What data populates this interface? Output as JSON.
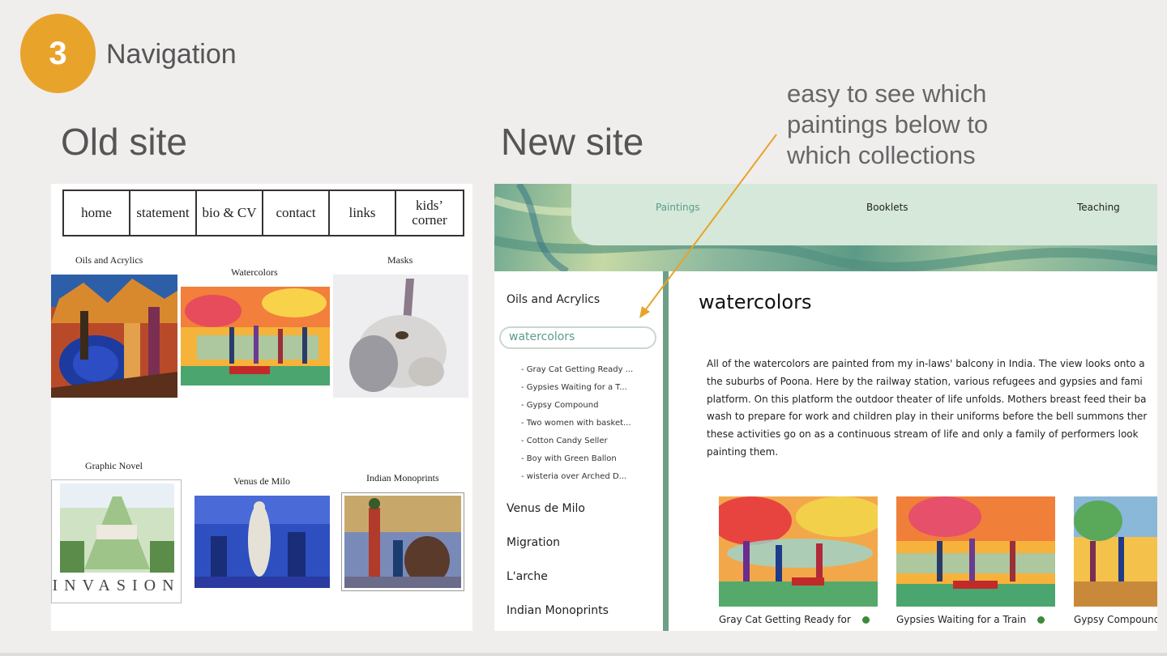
{
  "slide": {
    "badge_number": "3",
    "title": "Navigation",
    "old_heading": "Old site",
    "new_heading": "New site",
    "callout": "easy to see which paintings below to which collections",
    "accent_color": "#e8a32b"
  },
  "old_site": {
    "nav": [
      "home",
      "statement",
      "bio & CV",
      "contact",
      "links",
      "kids’ corner"
    ],
    "collections": [
      {
        "label": "Oils and Acrylics"
      },
      {
        "label": "Watercolors"
      },
      {
        "label": "Masks"
      },
      {
        "label": "Graphic Novel"
      },
      {
        "label": "Venus de Milo"
      },
      {
        "label": "Indian Monoprints"
      }
    ],
    "graphic_novel_caption": "INVASION"
  },
  "new_site": {
    "topnav": {
      "paintings": "Paintings",
      "booklets": "Booklets",
      "teaching": "Teaching"
    },
    "sidebar": {
      "oils": "Oils and Acrylics",
      "active": "watercolors",
      "sub_items": [
        "- Gray Cat Getting Ready ...",
        "- Gypsies Waiting for a T...",
        "- Gypsy Compound",
        "- Two women with basket...",
        "- Cotton Candy Seller",
        "- Boy with Green Ballon",
        "- wisteria over Arched D..."
      ],
      "venus": "Venus de Milo",
      "migration": "Migration",
      "larche": "L'arche",
      "indian": "Indian Monoprints"
    },
    "content": {
      "title": "watercolors",
      "paragraph_lines": [
        "All of the watercolors are painted from my in-laws' balcony in India. The view looks onto a",
        "the suburbs of Poona. Here by the railway station, various refugees and gypsies and fami",
        "platform. On this platform the outdoor theater of life unfolds. Mothers breast feed their ba",
        "wash to prepare for work and children play in their uniforms before the bell summons ther",
        "these activities go on as a continuous stream of life and only a family of performers look",
        "painting them."
      ],
      "cards": [
        {
          "caption": "Gray Cat Getting Ready for"
        },
        {
          "caption": "Gypsies Waiting for a Train"
        },
        {
          "caption": "Gypsy Compound"
        }
      ],
      "available_dot_color": "#3c8a3a",
      "active_color": "#5a9c8b"
    }
  }
}
